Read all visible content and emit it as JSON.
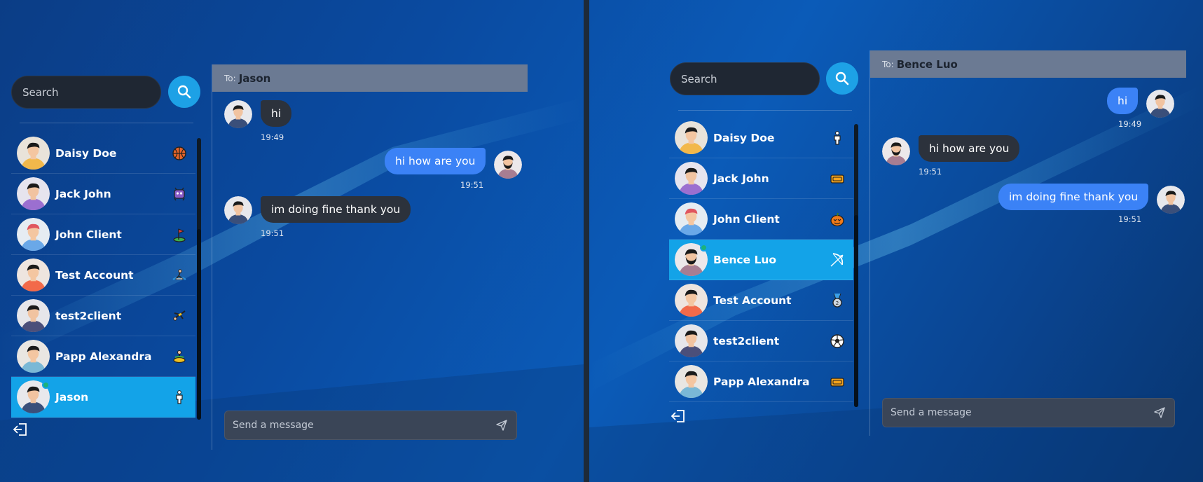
{
  "left": {
    "search": {
      "placeholder": "Search"
    },
    "contacts": [
      {
        "name": "Daisy Doe",
        "badge": "basketball-icon",
        "active": false
      },
      {
        "name": "Jack John",
        "badge": "alien-monster-icon",
        "active": false
      },
      {
        "name": "John Client",
        "badge": "golf-flag-icon",
        "active": false
      },
      {
        "name": "Test Account",
        "badge": "surfer-icon",
        "active": false
      },
      {
        "name": "test2client",
        "badge": "gymnast-icon",
        "active": false
      },
      {
        "name": "Papp Alexandra",
        "badge": "meditation-icon",
        "active": false
      },
      {
        "name": "Jason",
        "badge": "person-standing-icon",
        "active": true,
        "online": true
      }
    ],
    "chat": {
      "to_label": "To:",
      "recipient": "Jason",
      "messages": [
        {
          "dir": "in",
          "text": "hi",
          "time": "19:49"
        },
        {
          "dir": "out",
          "text": "hi how are you",
          "time": "19:51"
        },
        {
          "dir": "in",
          "text": "im doing fine thank you",
          "time": "19:51"
        }
      ],
      "composer_placeholder": "Send a message"
    }
  },
  "right": {
    "search": {
      "placeholder": "Search"
    },
    "contacts": [
      {
        "name": "Daisy Doe",
        "badge": "person-standing-icon",
        "active": false
      },
      {
        "name": "Jack John",
        "badge": "ticket-icon",
        "active": false
      },
      {
        "name": "John Client",
        "badge": "pumpkin-icon",
        "active": false
      },
      {
        "name": "Bence Luo",
        "badge": "bow-arrow-icon",
        "active": true,
        "online": true
      },
      {
        "name": "Test Account",
        "badge": "medal-icon",
        "active": false
      },
      {
        "name": "test2client",
        "badge": "soccer-ball-icon",
        "active": false
      },
      {
        "name": "Papp Alexandra",
        "badge": "ticket-icon",
        "active": false
      }
    ],
    "chat": {
      "to_label": "To:",
      "recipient": "Bence Luo",
      "messages": [
        {
          "dir": "out",
          "text": "hi",
          "time": "19:49"
        },
        {
          "dir": "in",
          "text": "hi how are you",
          "time": "19:51"
        },
        {
          "dir": "out",
          "text": "im doing fine thank you",
          "time": "19:51"
        }
      ],
      "composer_placeholder": "Send a message"
    }
  },
  "colors": {
    "accent": "#13a3e8",
    "bubble_out": "#3b82f6",
    "bubble_in": "#2c323c",
    "online": "#1db27a"
  }
}
